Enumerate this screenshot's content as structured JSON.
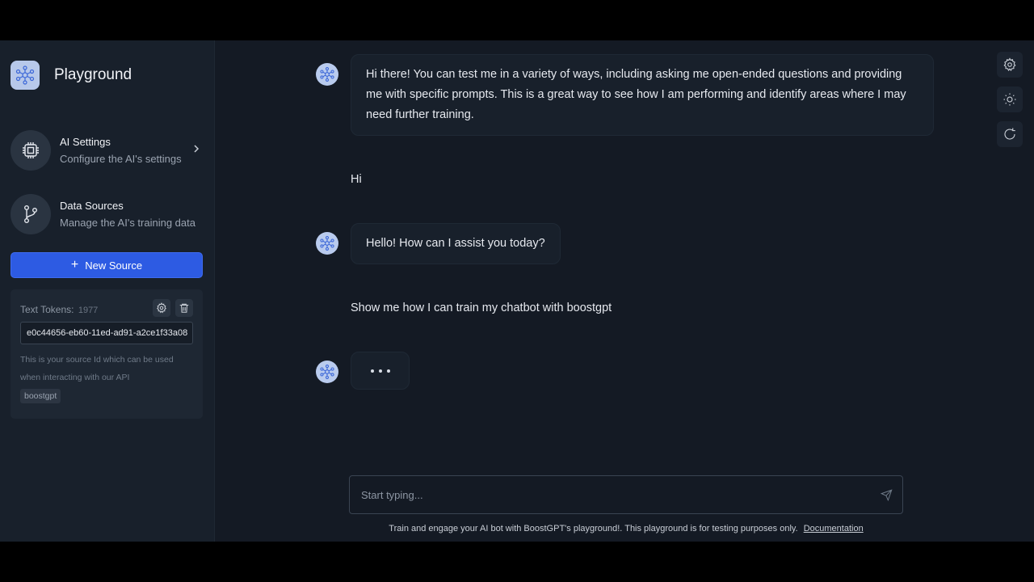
{
  "sidebar": {
    "title": "Playground",
    "logo_icon": "boostgpt-logo-icon",
    "nav": [
      {
        "title": "AI Settings",
        "subtitle": "Configure the AI's settings",
        "icon": "cpu-chip-icon"
      },
      {
        "title": "Data Sources",
        "subtitle": "Manage the AI's training data",
        "icon": "git-branch-icon"
      }
    ],
    "new_source_label": "New Source",
    "source": {
      "tokens_label": "Text Tokens:",
      "tokens_count": "1977",
      "source_id": "e0c44656-eb60-11ed-ad91-a2ce1f33a08",
      "help_text": "This is your source Id which can be used when interacting with our API",
      "tag": "boostgpt"
    }
  },
  "chat": {
    "messages": [
      {
        "role": "bot",
        "text": "Hi there! You can test me in a variety of ways, including asking me open-ended questions and providing me with specific prompts. This is a great way to see how I am performing and identify areas where I may need further training."
      },
      {
        "role": "user",
        "text": "Hi"
      },
      {
        "role": "bot",
        "text": "Hello! How can I assist you today?"
      },
      {
        "role": "user",
        "text": "Show me how I can train my chatbot with boostgpt"
      },
      {
        "role": "bot",
        "typing": true
      }
    ],
    "input_placeholder": "Start typing...",
    "footer_text": "Train and engage your AI bot with BoostGPT's playground!. This playground is for testing purposes only.",
    "footer_link": "Documentation"
  },
  "toolbar": {
    "icons": [
      "settings-icon",
      "sun-icon",
      "refresh-icon"
    ]
  },
  "colors": {
    "background": "#141a24",
    "sidebar": "#18202b",
    "accent": "#2d5be3",
    "avatar": "#b9cbee"
  }
}
